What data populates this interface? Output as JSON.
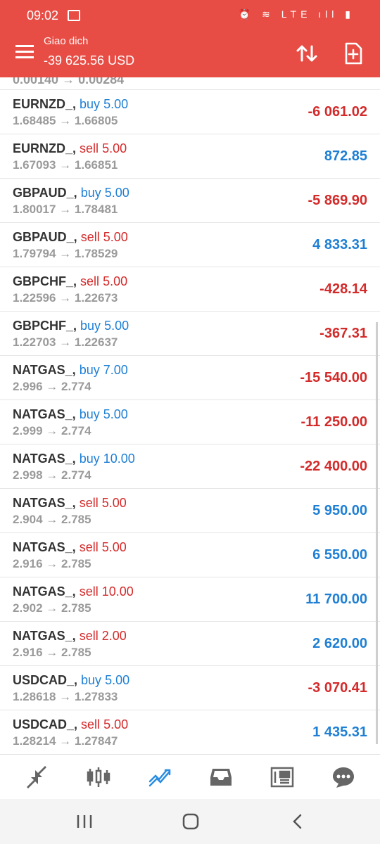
{
  "status": {
    "time": "09:02",
    "icons": "⏰ ≋ LTE ıll ▮"
  },
  "header": {
    "title": "Giao dich",
    "balance": "-39 625.56 USD"
  },
  "partial_row": "0.00140 → 0.00284",
  "positions": [
    {
      "symbol": "EURNZD_,",
      "side": "buy",
      "volume": "5.00",
      "prices": "1.68485 → 1.66805",
      "profit": "-6 061.02",
      "profit_sign": "neg"
    },
    {
      "symbol": "EURNZD_,",
      "side": "sell",
      "volume": "5.00",
      "prices": "1.67093 → 1.66851",
      "profit": "872.85",
      "profit_sign": "pos"
    },
    {
      "symbol": "GBPAUD_,",
      "side": "buy",
      "volume": "5.00",
      "prices": "1.80017 → 1.78481",
      "profit": "-5 869.90",
      "profit_sign": "neg"
    },
    {
      "symbol": "GBPAUD_,",
      "side": "sell",
      "volume": "5.00",
      "prices": "1.79794 → 1.78529",
      "profit": "4 833.31",
      "profit_sign": "pos"
    },
    {
      "symbol": "GBPCHF_,",
      "side": "sell",
      "volume": "5.00",
      "prices": "1.22596 → 1.22673",
      "profit": "-428.14",
      "profit_sign": "neg"
    },
    {
      "symbol": "GBPCHF_,",
      "side": "buy",
      "volume": "5.00",
      "prices": "1.22703 → 1.22637",
      "profit": "-367.31",
      "profit_sign": "neg"
    },
    {
      "symbol": "NATGAS_,",
      "side": "buy",
      "volume": "7.00",
      "prices": "2.996 → 2.774",
      "profit": "-15 540.00",
      "profit_sign": "neg"
    },
    {
      "symbol": "NATGAS_,",
      "side": "buy",
      "volume": "5.00",
      "prices": "2.999 → 2.774",
      "profit": "-11 250.00",
      "profit_sign": "neg"
    },
    {
      "symbol": "NATGAS_,",
      "side": "buy",
      "volume": "10.00",
      "prices": "2.998 → 2.774",
      "profit": "-22 400.00",
      "profit_sign": "neg"
    },
    {
      "symbol": "NATGAS_,",
      "side": "sell",
      "volume": "5.00",
      "prices": "2.904 → 2.785",
      "profit": "5 950.00",
      "profit_sign": "pos"
    },
    {
      "symbol": "NATGAS_,",
      "side": "sell",
      "volume": "5.00",
      "prices": "2.916 → 2.785",
      "profit": "6 550.00",
      "profit_sign": "pos"
    },
    {
      "symbol": "NATGAS_,",
      "side": "sell",
      "volume": "10.00",
      "prices": "2.902 → 2.785",
      "profit": "11 700.00",
      "profit_sign": "pos"
    },
    {
      "symbol": "NATGAS_,",
      "side": "sell",
      "volume": "2.00",
      "prices": "2.916 → 2.785",
      "profit": "2 620.00",
      "profit_sign": "pos"
    },
    {
      "symbol": "USDCAD_,",
      "side": "buy",
      "volume": "5.00",
      "prices": "1.28618 → 1.27833",
      "profit": "-3 070.41",
      "profit_sign": "neg"
    },
    {
      "symbol": "USDCAD_,",
      "side": "sell",
      "volume": "5.00",
      "prices": "1.28214 → 1.27847",
      "profit": "1 435.31",
      "profit_sign": "pos"
    }
  ],
  "bottom_nav": [
    {
      "name": "quotes",
      "icon": "arrows-icon"
    },
    {
      "name": "chart",
      "icon": "candlestick-icon"
    },
    {
      "name": "trade",
      "icon": "trend-icon",
      "active": true
    },
    {
      "name": "history",
      "icon": "inbox-icon"
    },
    {
      "name": "news",
      "icon": "newspaper-icon"
    },
    {
      "name": "chat",
      "icon": "chat-icon"
    }
  ],
  "colors": {
    "header": "#e84d45",
    "buy": "#1e7fd4",
    "sell": "#d42a2a",
    "active_nav": "#2b8de0"
  }
}
